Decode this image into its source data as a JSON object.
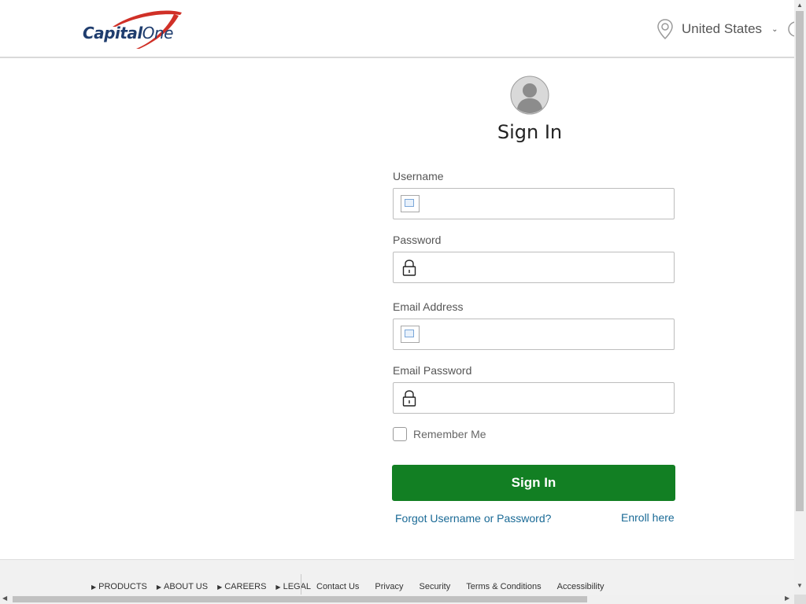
{
  "header": {
    "brand_name_part1": "Capital",
    "brand_name_part2": "One",
    "region_label": "United States",
    "brand_color": "#1f3d6e",
    "swoosh_color": "#d03027"
  },
  "form": {
    "title": "Sign In",
    "fields": [
      {
        "label": "Username",
        "icon": "image-placeholder-icon",
        "value": ""
      },
      {
        "label": "Password",
        "icon": "lock-icon",
        "value": ""
      },
      {
        "label": "Email Address",
        "icon": "image-placeholder-icon",
        "value": ""
      },
      {
        "label": "Email Password",
        "icon": "lock-icon",
        "value": ""
      }
    ],
    "remember_label": "Remember Me",
    "remember_checked": false,
    "submit_label": "Sign In",
    "submit_color": "#127f23",
    "forgot_link": "Forgot Username or Password?",
    "enroll_link": "Enroll here"
  },
  "footer": {
    "nav": [
      "PRODUCTS",
      "ABOUT US",
      "CAREERS",
      "LEGAL"
    ],
    "links": [
      "Contact Us",
      "Privacy",
      "Security",
      "Terms & Conditions",
      "Accessibility"
    ]
  }
}
